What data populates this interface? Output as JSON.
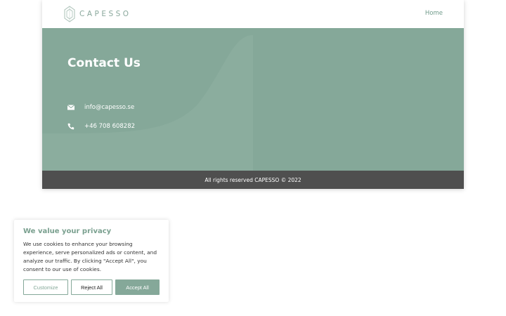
{
  "header": {
    "logo_text": "CAPESSO",
    "nav_home": "Home"
  },
  "hero": {
    "title": "Contact Us",
    "email": "info@capesso.se",
    "phone": "+46 708 608282",
    "icons": {
      "email": "envelope-icon",
      "phone": "phone-icon"
    }
  },
  "footer": {
    "text": "All rights reserved CAPESSO © 2022"
  },
  "cookie": {
    "title": "We value your privacy",
    "body": "We use cookies to enhance your browsing experience, serve personalized ads or content, and analyze our traffic. By clicking \"Accept All\", you consent to our use of cookies.",
    "customize": "Customize",
    "reject": "Reject All",
    "accept": "Accept All"
  },
  "colors": {
    "accent": "#85a899",
    "footer": "#4f4f4f",
    "text": "#333333"
  }
}
